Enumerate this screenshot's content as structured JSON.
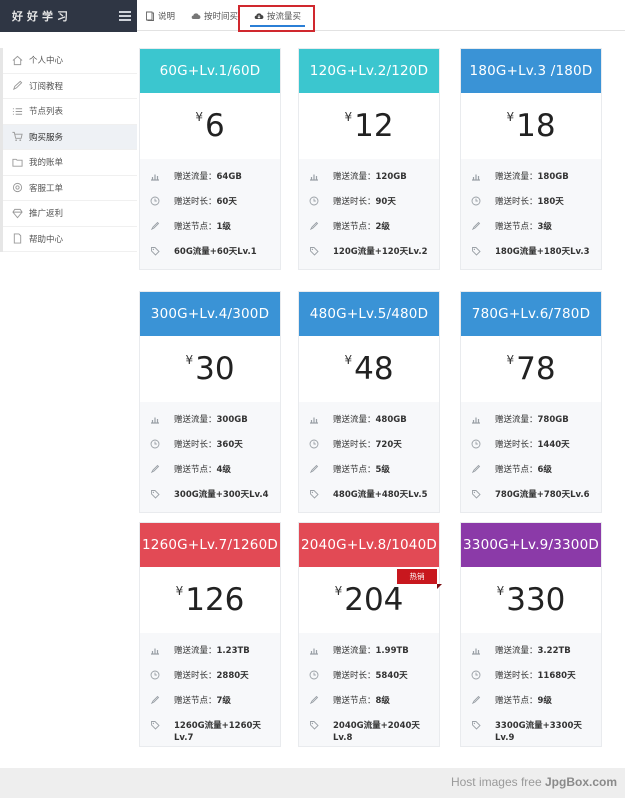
{
  "brand": {
    "title": "好好学习"
  },
  "sidebar": {
    "items": [
      {
        "label": "个人中心",
        "icon": "home-icon"
      },
      {
        "label": "订阅教程",
        "icon": "pencil-icon"
      },
      {
        "label": "节点列表",
        "icon": "list-icon"
      },
      {
        "label": "购买服务",
        "icon": "cart-icon",
        "active": true
      },
      {
        "label": "我的账单",
        "icon": "folder-icon"
      },
      {
        "label": "客服工单",
        "icon": "ticket-icon"
      },
      {
        "label": "推广返利",
        "icon": "diamond-icon"
      },
      {
        "label": "帮助中心",
        "icon": "file-icon"
      }
    ]
  },
  "tabs": [
    {
      "label": "说明",
      "icon": "book-icon"
    },
    {
      "label": "按时间买",
      "icon": "cloud-icon"
    },
    {
      "label": "按流量买",
      "icon": "cloud-download-icon",
      "active": true
    }
  ],
  "colors": {
    "teal": "#3bc6cf",
    "blue": "#3a93d6",
    "red": "#e24a55",
    "purple": "#8b3aa8",
    "hot": "#c8171e"
  },
  "labels": {
    "traffic": "赠送流量：",
    "duration": "赠送时长：",
    "nodes": "赠送节点：",
    "currency": "¥",
    "hot": "热销"
  },
  "plans": [
    {
      "name": "60G+Lv.1/60D",
      "price": "6",
      "traffic": "64GB",
      "duration": "60天",
      "nodes": "1级",
      "tag": "60G流量+60天Lv.1"
    },
    {
      "name": "120G+Lv.2/120D",
      "price": "12",
      "traffic": "120GB",
      "duration": "90天",
      "nodes": "2级",
      "tag": "120G流量+120天Lv.2"
    },
    {
      "name": "180G+Lv.3 /180D",
      "price": "18",
      "traffic": "180GB",
      "duration": "180天",
      "nodes": "3级",
      "tag": "180G流量+180天Lv.3"
    },
    {
      "name": "300G+Lv.4/300D",
      "price": "30",
      "traffic": "300GB",
      "duration": "360天",
      "nodes": "4级",
      "tag": "300G流量+300天Lv.4"
    },
    {
      "name": "480G+Lv.5/480D",
      "price": "48",
      "traffic": "480GB",
      "duration": "720天",
      "nodes": "5级",
      "tag": "480G流量+480天Lv.5"
    },
    {
      "name": "780G+Lv.6/780D",
      "price": "78",
      "traffic": "780GB",
      "duration": "1440天",
      "nodes": "6级",
      "tag": "780G流量+780天Lv.6"
    },
    {
      "name": "1260G+Lv.7/1260D",
      "price": "126",
      "traffic": "1.23TB",
      "duration": "2880天",
      "nodes": "7级",
      "tag": "1260G流量+1260天Lv.7"
    },
    {
      "name": "2040G+Lv.8/1040D",
      "price": "204",
      "traffic": "1.99TB",
      "duration": "5840天",
      "nodes": "8级",
      "tag": "2040G流量+2040天Lv.8",
      "hot": true
    },
    {
      "name": "3300G+Lv.9/3300D",
      "price": "330",
      "traffic": "3.22TB",
      "duration": "11680天",
      "nodes": "9级",
      "tag": "3300G流量+3300天Lv.9"
    }
  ],
  "watermark": {
    "prefix": "Host images free ",
    "site": "JpgBox.com"
  }
}
